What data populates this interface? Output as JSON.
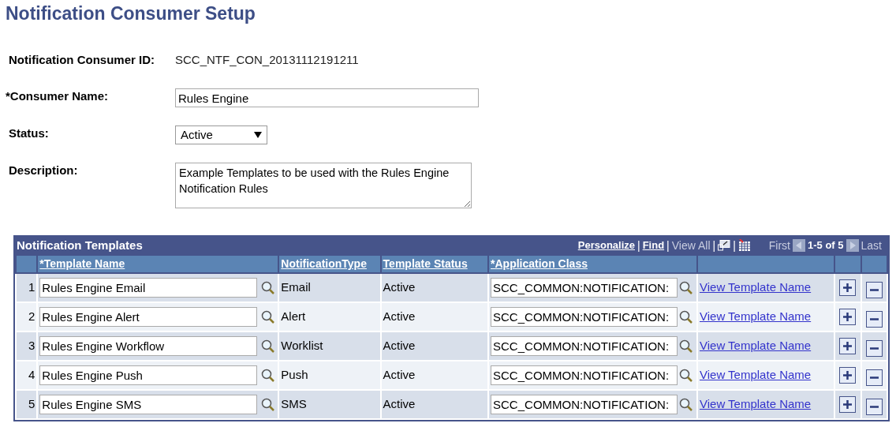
{
  "page_title": "Notification Consumer Setup",
  "fields": [
    {
      "kind": "display",
      "label": "Notification Consumer ID:",
      "value": "SCC_NTF_CON_20131112191211"
    },
    {
      "kind": "input",
      "label": "*Consumer Name:",
      "value": "Rules Engine"
    },
    {
      "kind": "select",
      "label": "Status:",
      "value": "Active"
    },
    {
      "kind": "textarea",
      "label": "Description:",
      "value": "Example Templates to be used with the Rules Engine Notification Rules"
    }
  ],
  "grid": {
    "title": "Notification Templates",
    "toolbar": {
      "personalize": "Personalize",
      "find": "Find",
      "view_all": "View All",
      "first": "First",
      "range": "1-5 of 5",
      "last": "Last",
      "separators": [
        "|",
        "|",
        "|",
        "|"
      ]
    },
    "columns": [
      "*Template Name",
      "NotificationType",
      "Template Status",
      "*Application Class"
    ],
    "rows": [
      {
        "number": "1",
        "template_name": "Rules Engine Email",
        "type": "Email",
        "status": "Active",
        "app_class": "SCC_COMMON:NOTIFICATION:",
        "link": "View Template Name"
      },
      {
        "number": "2",
        "template_name": "Rules Engine Alert",
        "type": "Alert",
        "status": "Active",
        "app_class": "SCC_COMMON:NOTIFICATION:",
        "link": "View Template Name"
      },
      {
        "number": "3",
        "template_name": "Rules Engine Workflow",
        "type": "Worklist",
        "status": "Active",
        "app_class": "SCC_COMMON:NOTIFICATION:",
        "link": "View Template Name"
      },
      {
        "number": "4",
        "template_name": "Rules Engine Push",
        "type": "Push",
        "status": "Active",
        "app_class": "SCC_COMMON:NOTIFICATION:",
        "link": "View Template Name"
      },
      {
        "number": "5",
        "template_name": "Rules Engine SMS",
        "type": "SMS",
        "status": "Active",
        "app_class": "SCC_COMMON:NOTIFICATION:",
        "link": "View Template Name"
      }
    ]
  }
}
